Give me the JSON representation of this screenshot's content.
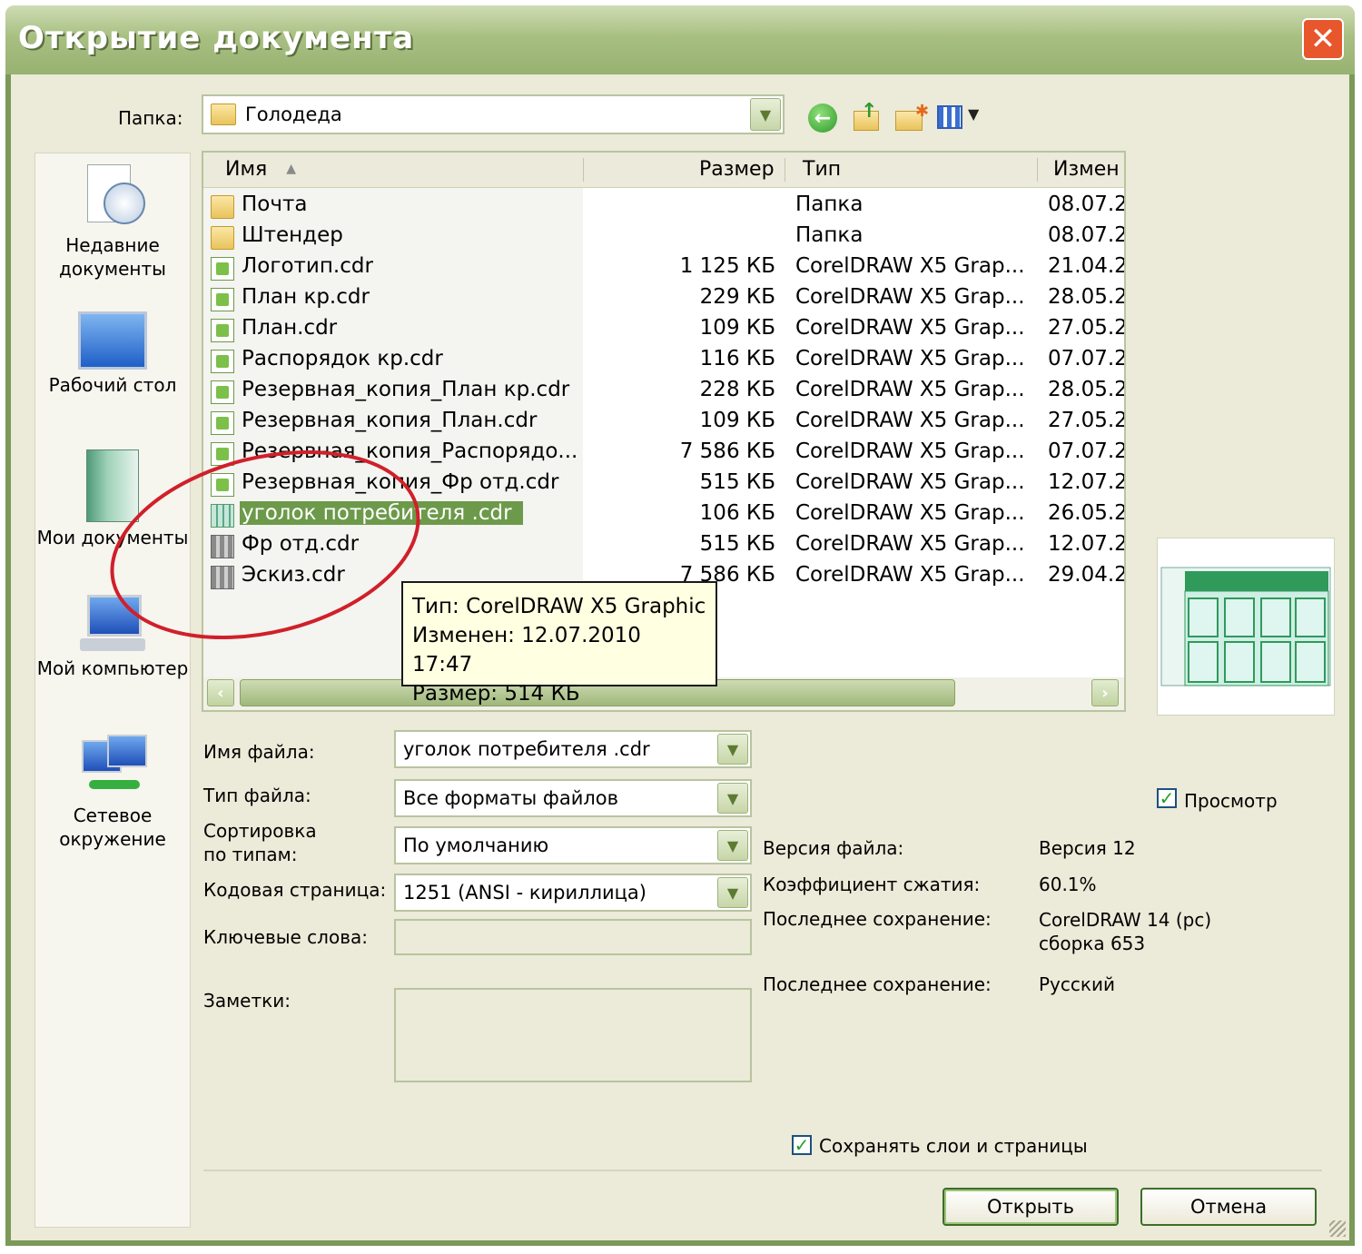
{
  "window": {
    "title": "Открытие документа",
    "close_glyph": "✕"
  },
  "toolbar": {
    "folder_label": "Папка:",
    "folder_value": "Голодеда",
    "icons": [
      "back-icon",
      "up-folder-icon",
      "new-folder-icon",
      "view-menu-icon"
    ]
  },
  "places": [
    {
      "label": "Недавние документы",
      "icon": "recent-documents-icon"
    },
    {
      "label": "Рабочий стол",
      "icon": "desktop-icon"
    },
    {
      "label": "Мои документы",
      "icon": "my-documents-icon"
    },
    {
      "label": "Мой компьютер",
      "icon": "my-computer-icon"
    },
    {
      "label": "Сетевое окружение",
      "icon": "network-icon"
    }
  ],
  "list": {
    "headers": {
      "name": "Имя",
      "size": "Размер",
      "type": "Тип",
      "modified": "Измен"
    },
    "rows": [
      {
        "name": "Почта",
        "size": "",
        "type": "Папка",
        "modified": "08.07.2",
        "icon": "folder"
      },
      {
        "name": "Штендер",
        "size": "",
        "type": "Папка",
        "modified": "08.07.2",
        "icon": "folder"
      },
      {
        "name": "Логотип.cdr",
        "size": "1 125 КБ",
        "type": "CorelDRAW X5 Grap...",
        "modified": "21.04.2",
        "icon": "cdr"
      },
      {
        "name": "План кр.cdr",
        "size": "229 КБ",
        "type": "CorelDRAW X5 Grap...",
        "modified": "28.05.2",
        "icon": "cdr"
      },
      {
        "name": "План.cdr",
        "size": "109 КБ",
        "type": "CorelDRAW X5 Grap...",
        "modified": "27.05.2",
        "icon": "cdr"
      },
      {
        "name": "Распорядок кр.cdr",
        "size": "116 КБ",
        "type": "CorelDRAW X5 Grap...",
        "modified": "07.07.2",
        "icon": "cdr"
      },
      {
        "name": "Резервная_копия_План кр.cdr",
        "size": "228 КБ",
        "type": "CorelDRAW X5 Grap...",
        "modified": "28.05.2",
        "icon": "cdr"
      },
      {
        "name": "Резервная_копия_План.cdr",
        "size": "109 КБ",
        "type": "CorelDRAW X5 Grap...",
        "modified": "27.05.2",
        "icon": "cdr"
      },
      {
        "name": "Резервная_копия_Распорядо...",
        "size": "7 586 КБ",
        "type": "CorelDRAW X5 Grap...",
        "modified": "07.07.2",
        "icon": "cdr"
      },
      {
        "name": "Резервная_копия_Фр отд.cdr",
        "size": "515 КБ",
        "type": "CorelDRAW X5 Grap...",
        "modified": "12.07.2",
        "icon": "cdr"
      },
      {
        "name": "уголок потребителя .cdr",
        "size": "106 КБ",
        "type": "CorelDRAW X5 Grap...",
        "modified": "26.05.2",
        "icon": "thumb-green",
        "selected": true
      },
      {
        "name": "Фр отд.cdr",
        "size": "515 КБ",
        "type": "CorelDRAW X5 Grap...",
        "modified": "12.07.2",
        "icon": "thumb"
      },
      {
        "name": "Эскиз.cdr",
        "size": "7 586 КБ",
        "type": "CorelDRAW X5 Grap...",
        "modified": "29.04.2",
        "icon": "thumb"
      }
    ]
  },
  "tooltip": {
    "line1": "Тип: CorelDRAW X5 Graphic",
    "line2": "Изменен: 12.07.2010 17:47",
    "line3": "Размер: 514 КБ"
  },
  "form": {
    "filename_label": "Имя файла:",
    "filename_value": "уголок потребителя .cdr",
    "filetype_label": "Тип файла:",
    "filetype_value": "Все форматы файлов",
    "sort_label_1": "Сортировка",
    "sort_label_2": "по типам:",
    "sort_value": "По умолчанию",
    "codepage_label": "Кодовая страница:",
    "codepage_value": "1251  (ANSI - кириллица)",
    "keywords_label": "Ключевые слова:",
    "keywords_value": "",
    "notes_label": "Заметки:",
    "notes_value": ""
  },
  "info": {
    "version_label": "Версия файла:",
    "version_value": "Версия 12",
    "compression_label": "Коэффициент сжатия:",
    "compression_value": "60.1%",
    "last_saved_label": "Последнее сохранение:",
    "last_saved_value_1": "CorelDRAW 14 (pc)",
    "last_saved_value_2": "сборка 653",
    "last_saved_lang_label": "Последнее сохранение:",
    "last_saved_lang_value": "Русский"
  },
  "preview": {
    "label": "Просмотр",
    "checked": true
  },
  "keep_layers": {
    "label": "Сохранять слои и страницы",
    "checked": true
  },
  "buttons": {
    "open": "Открыть",
    "cancel": "Отмена"
  },
  "colors": {
    "title_bar": "#a8bf82",
    "selection": "#6c9a4a",
    "annotation_circle": "#d0202a",
    "tooltip_bg": "#ffffe1"
  }
}
